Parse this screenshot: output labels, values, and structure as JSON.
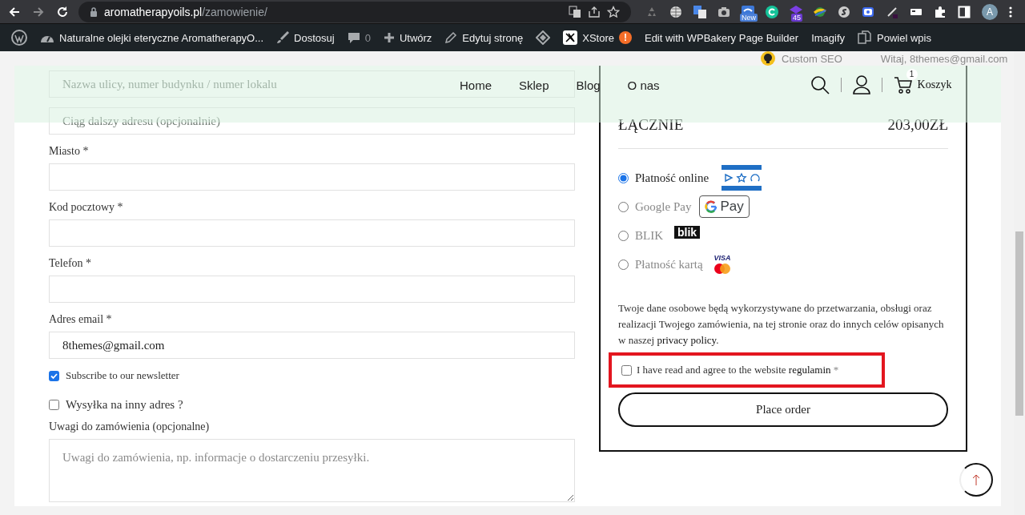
{
  "browser": {
    "url_host": "aromatherapyoils.pl",
    "url_path": "/zamowienie/",
    "new_badge": "New",
    "count_badge": "45",
    "avatar": "A"
  },
  "admin_bar": {
    "items": [
      {
        "kind": "wordpress"
      },
      {
        "kind": "site",
        "label": "Naturalne olejki eteryczne AromatherapyO..."
      },
      {
        "kind": "customize",
        "label": "Dostosuj"
      },
      {
        "kind": "comments",
        "label": "0"
      },
      {
        "kind": "new",
        "label": "Utwórz"
      },
      {
        "kind": "edit",
        "label": "Edytuj stronę"
      },
      {
        "kind": "diamond"
      },
      {
        "kind": "xstore",
        "label": "XStore",
        "alert": "!"
      },
      {
        "kind": "plain",
        "label": "Edit with WPBakery Page Builder"
      },
      {
        "kind": "plain",
        "label": "Imagify"
      },
      {
        "kind": "duplicate",
        "label": "Powiel wpis"
      }
    ]
  },
  "admin_overlay": {
    "seo": "Custom SEO",
    "greeting": "Witaj, 8themes@gmail.com"
  },
  "header": {
    "nav": [
      {
        "label": "Home"
      },
      {
        "label": "Sklep"
      },
      {
        "label": "Blog"
      },
      {
        "label": "O nas"
      }
    ],
    "cart_count": "1",
    "cart_label": "Koszyk"
  },
  "billing": {
    "fields": [
      {
        "kind": "input",
        "placeholder": "Nazwa ulicy, numer budynku / numer lokalu"
      },
      {
        "kind": "input",
        "placeholder": "Ciąg dalszy adresu (opcjonalnie)"
      },
      {
        "kind": "input",
        "label": "Miasto *"
      },
      {
        "kind": "input",
        "label": "Kod pocztowy *"
      },
      {
        "kind": "input",
        "label": "Telefon *"
      },
      {
        "kind": "input",
        "label": "Adres email *",
        "value": "8themes@gmail.com"
      },
      {
        "kind": "checkbox",
        "label": "Subscribe to our newsletter",
        "checked": true
      },
      {
        "kind": "section-checkbox",
        "label": "Wysyłka na inny adres ?",
        "checked": false
      },
      {
        "kind": "textarea",
        "label": "Uwagi do zamówienia (opcjonalne)",
        "placeholder": "Uwagi do zamówienia, np. informacje o dostarczeniu przesyłki."
      }
    ]
  },
  "order": {
    "total_label": "ŁĄCZNIE",
    "total_value": "203,00ZŁ",
    "payment_methods": [
      {
        "label": "Płatność online",
        "selected": true,
        "kind": "bluemedia"
      },
      {
        "label": "Google Pay",
        "selected": false,
        "kind": "gpay",
        "logo_text": "Pay"
      },
      {
        "label": "BLIK",
        "selected": false,
        "kind": "blik",
        "logo_text": "blik"
      },
      {
        "label": "Płatność kartą",
        "selected": false,
        "kind": "card",
        "logo_text": "VISA"
      }
    ],
    "privacy": {
      "before": "Twoje dane osobowe będą wykorzystywane do przetwarzania, obsługi oraz realizacji Twojego zamówienia, na tej stronie oraz do innych celów opisanych w naszej ",
      "link": "privacy policy",
      "after": "."
    },
    "terms": {
      "before": "I have read and agree to the website ",
      "link": "regulamin",
      "after": " *",
      "checked": false,
      "highlighted": true
    },
    "place_order": "Place order"
  }
}
